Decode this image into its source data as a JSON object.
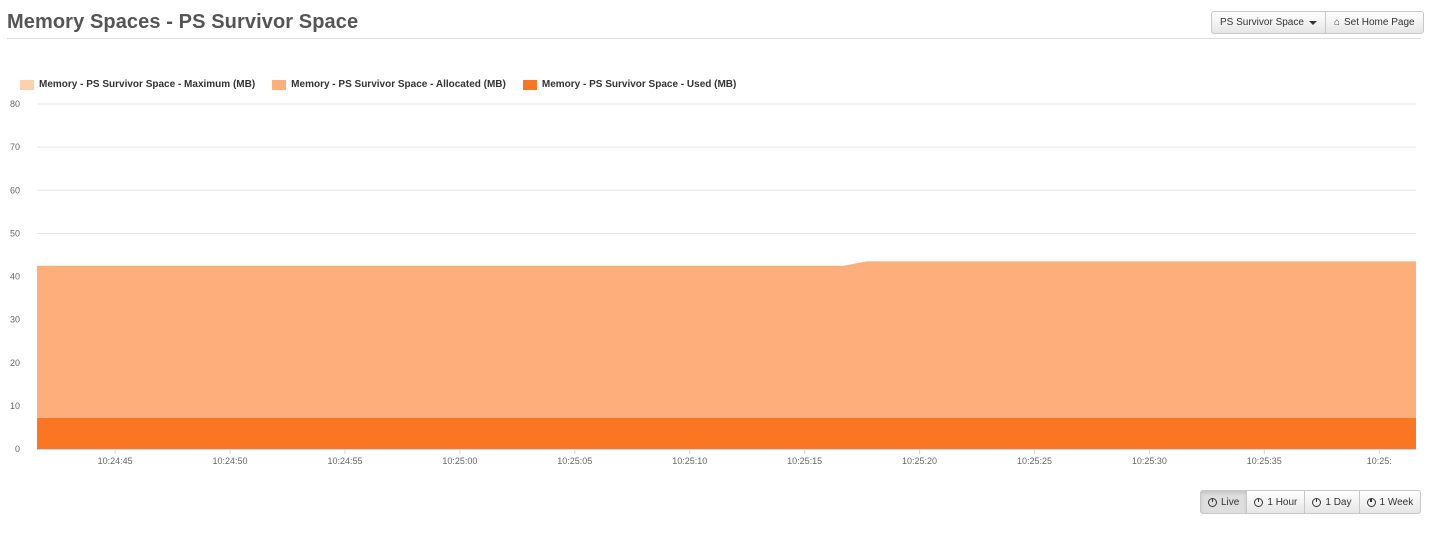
{
  "page": {
    "title": "Memory Spaces - PS Survivor Space"
  },
  "toolbar": {
    "space_select_label": "PS Survivor Space",
    "set_home_label": "Set Home Page"
  },
  "range_buttons": [
    {
      "label": "Live",
      "active": true
    },
    {
      "label": "1 Hour",
      "active": false
    },
    {
      "label": "1 Day",
      "active": false
    },
    {
      "label": "1 Week",
      "active": false
    }
  ],
  "colors": {
    "maximum": "#fdd0ae",
    "allocated": "#fdae7b",
    "used": "#fb7623",
    "grid": "#e6e6e6",
    "axis_text": "#666666"
  },
  "chart_data": {
    "type": "area",
    "title": "",
    "xlabel": "",
    "ylabel": "",
    "ylim": [
      0,
      80
    ],
    "yticks": [
      "0",
      "10",
      "20",
      "30",
      "40",
      "50",
      "60",
      "70",
      "80"
    ],
    "xlim": [
      "10:24:41.6",
      "10:25:41.6"
    ],
    "xticks": [
      "10:24:45",
      "10:24:50",
      "10:24:55",
      "10:25:00",
      "10:25:05",
      "10:25:10",
      "10:25:15",
      "10:25:20",
      "10:25:25",
      "10:25:30",
      "10:25:35",
      "10:25:"
    ],
    "x": [
      "10:24:41.6",
      "10:25:16.7",
      "10:25:17.7",
      "10:25:41.6"
    ],
    "grid": true,
    "legend_position": "top-left",
    "series": [
      {
        "name": "Memory - PS Survivor Space - Maximum (MB)",
        "color": "#fdd0ae",
        "values": [
          null,
          null,
          null,
          null
        ]
      },
      {
        "name": "Memory - PS Survivor Space - Allocated (MB)",
        "color": "#fdae7b",
        "values": [
          42.5,
          42.5,
          43.5,
          43.5
        ]
      },
      {
        "name": "Memory - PS Survivor Space - Used (MB)",
        "color": "#fb7623",
        "values": [
          7.2,
          7.2,
          7.2,
          7.2
        ]
      }
    ]
  }
}
